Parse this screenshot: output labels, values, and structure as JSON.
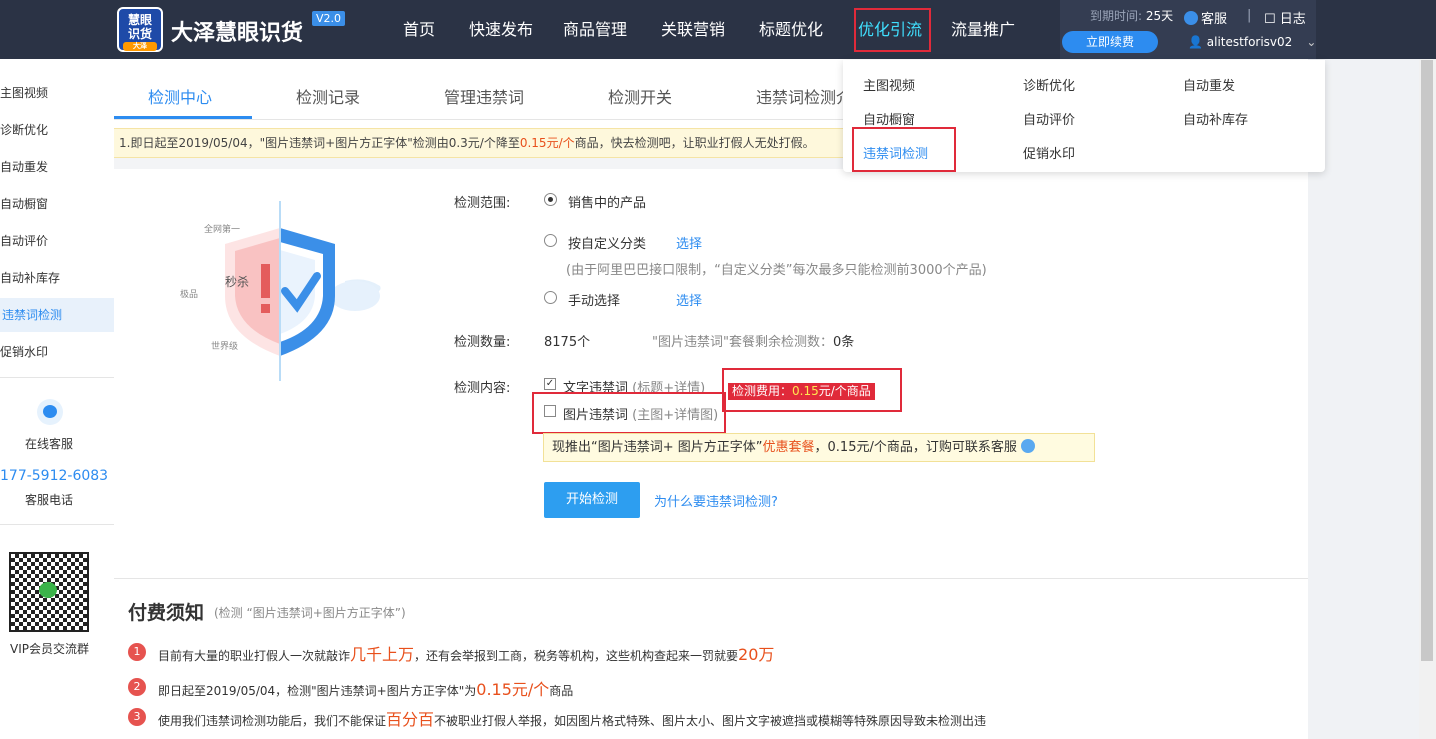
{
  "header": {
    "logo_line1": "慧眼",
    "logo_line2": "识货",
    "logo_sub": "大泽",
    "brand": "大泽慧眼识货",
    "version": "V2.0",
    "nav": [
      "首页",
      "快速发布",
      "商品管理",
      "关联营销",
      "标题优化",
      "优化引流",
      "流量推广"
    ],
    "active_nav": "优化引流",
    "expire_label": "到期时间:",
    "expire_value": "25天",
    "renew": "立即续费",
    "service": "客服",
    "separator": "|",
    "log": "日志",
    "user": "alitestforisv02"
  },
  "dropdown": {
    "col1": [
      "主图视频",
      "自动橱窗",
      "违禁词检测"
    ],
    "col2": [
      "诊断优化",
      "自动评价",
      "促销水印"
    ],
    "col3": [
      "自动重发",
      "自动补库存"
    ],
    "active": "违禁词检测"
  },
  "sidebar": {
    "items": [
      "主图视频",
      "诊断优化",
      "自动重发",
      "自动橱窗",
      "自动评价",
      "自动补库存",
      "违禁词检测",
      "促销水印"
    ],
    "active": "违禁词检测",
    "online_service": "在线客服",
    "phone": "177-5912-6083",
    "phone_label": "客服电话",
    "qr_label": "VIP会员交流群"
  },
  "tabs": [
    "检测中心",
    "检测记录",
    "管理违禁词",
    "检测开关",
    "违禁词检测介"
  ],
  "notice": {
    "prefix": "1.即日起至2019/05/04，\"图片违禁词+图片方正字体\"检测由0.3元/个降至",
    "highlight": "0.15元/个",
    "suffix": "商品，快去检测吧，让职业打假人无处打假。"
  },
  "illustration": {
    "t1": "全网第一",
    "t2": "秒杀",
    "t3": "极品",
    "t4": "世界级"
  },
  "form": {
    "scope_label": "检测范围:",
    "scope_opt1": "销售中的产品",
    "scope_opt2": "按自定义分类",
    "select_link": "选择",
    "scope_note": "(由于阿里巴巴接口限制，“自定义分类”每次最多只能检测前3000个产品)",
    "scope_opt3": "手动选择",
    "count_label": "检测数量:",
    "count_value": "8175个",
    "remain_text": "\"图片违禁词\"套餐剩余检测数：",
    "remain_value": "0条",
    "content_label": "检测内容:",
    "content_opt1": "文字违禁词",
    "content_opt1_note": "(标题+详情)",
    "content_opt2": "图片违禁词",
    "content_opt2_note": "(主图+详情图)",
    "fee_prefix": "检测费用：",
    "fee_value": "0.15",
    "fee_suffix": "元/个商品",
    "promo_prefix": "现推出“图片违禁词+ 图片方正字体”",
    "promo_highlight": "优惠套餐",
    "promo_suffix": "，0.15元/个商品，订购可联系客服",
    "start_btn": "开始检测",
    "why_link": "为什么要违禁词检测?"
  },
  "pay": {
    "title": "付费须知",
    "subtitle": "(检测 “图片违禁词+图片方正字体”)",
    "rows": [
      {
        "num": "1",
        "a": "目前有大量的职业打假人一次就敲诈",
        "b": "几千上万",
        "c": "，还有会举报到工商，税务等机构，这些机构查起来一罚就要",
        "d": "20万",
        "e": ""
      },
      {
        "num": "2",
        "a": "即日起至2019/05/04，检测\"图片违禁词+图片方正字体\"为",
        "b": "0.15元/个",
        "c": "商品",
        "d": "",
        "e": ""
      },
      {
        "num": "3",
        "a": "使用我们违禁词检测功能后，我们不能保证",
        "b": "百分百",
        "c": "不被职业打假人举报，如因图片格式特殊、图片太小、图片文字被遮挡或模糊等特殊原因导致未检测出违",
        "d": "",
        "e": ""
      }
    ]
  }
}
